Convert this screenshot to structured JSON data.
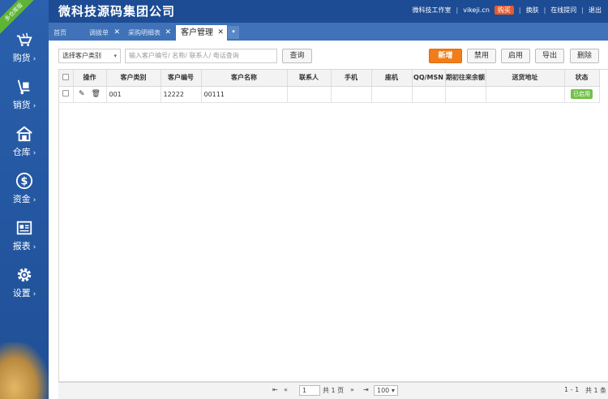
{
  "sidebar": {
    "ribbon": "多仓库版",
    "items": [
      {
        "label": "购货",
        "icon": "cart-icon"
      },
      {
        "label": "销货",
        "icon": "trolley-icon"
      },
      {
        "label": "仓库",
        "icon": "house-icon"
      },
      {
        "label": "资金",
        "icon": "dollar-icon"
      },
      {
        "label": "报表",
        "icon": "report-icon"
      },
      {
        "label": "设置",
        "icon": "gear-icon"
      }
    ],
    "chevron": "›"
  },
  "header": {
    "brand": "微科技源码集团公司",
    "links": {
      "studio": "微科技工作室",
      "domain": "vikeji.cn",
      "buy": "购买",
      "skin": "换肤",
      "help": "在线提问",
      "logout": "退出"
    }
  },
  "tabs": [
    {
      "label": "首页"
    },
    {
      "label": "调拨单"
    },
    {
      "label": "采购明细表"
    },
    {
      "label": "客户管理"
    }
  ],
  "tab_close": "✕",
  "toolbar": {
    "category_select": "选择客户类别",
    "search_placeholder": "输入客户编号/ 名称/ 联系人/ 电话查询",
    "query": "查询",
    "add": "新增",
    "disable": "禁用",
    "enable": "启用",
    "export": "导出",
    "delete": "删除"
  },
  "table": {
    "columns": [
      "操作",
      "客户类别",
      "客户编号",
      "客户名称",
      "联系人",
      "手机",
      "座机",
      "QQ/MSN",
      "期初往来余额",
      "送货地址",
      "状态"
    ],
    "rows": [
      {
        "category": "001",
        "code": "12222",
        "name": "00111",
        "contact": "",
        "mobile": "",
        "phone": "",
        "qq": "",
        "balance": "",
        "address": "",
        "status": "已启用"
      }
    ]
  },
  "pager": {
    "page": "1",
    "total_pages": "共 1 页",
    "page_size": "100",
    "range": "1 - 1",
    "total": "共 1 条"
  },
  "colors": {
    "header": "#1d4c94",
    "sidebar": "#2a60ad",
    "primary_button": "#f07d1a",
    "status_badge": "#72c24a"
  }
}
